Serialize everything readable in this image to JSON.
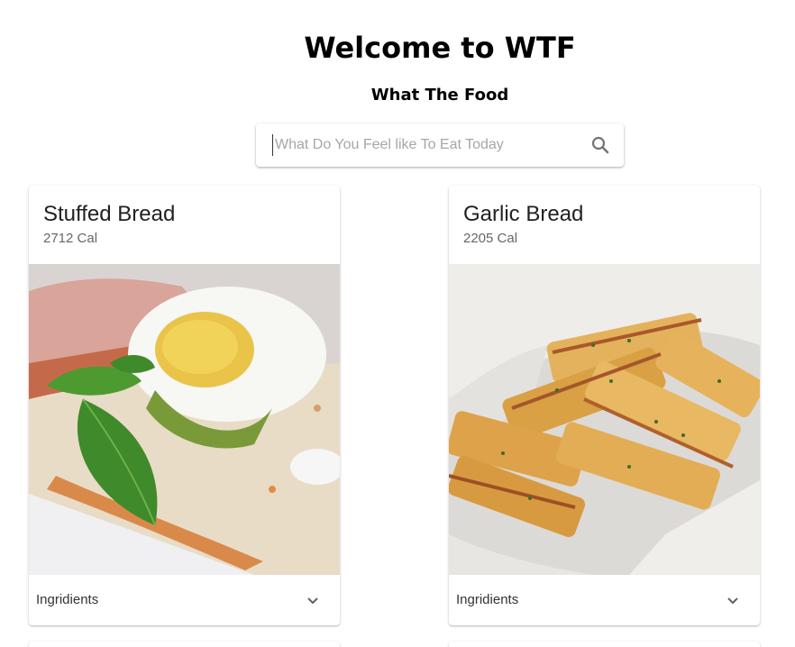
{
  "header": {
    "title": "Welcome to WTF",
    "subtitle": "What The Food"
  },
  "search": {
    "placeholder": "What Do You Feel like To Eat Today",
    "value": "",
    "icon": "search-icon"
  },
  "cards": [
    {
      "title": "Stuffed Bread",
      "calories": "2712 Cal",
      "image": "stuffed-bread-photo",
      "footer_label": "Ingridients",
      "expand_icon": "chevron-down-icon"
    },
    {
      "title": "Garlic Bread",
      "calories": "2205 Cal",
      "image": "garlic-bread-photo",
      "footer_label": "Ingridients",
      "expand_icon": "chevron-down-icon"
    }
  ],
  "colors": {
    "text_primary": "#212121",
    "text_secondary": "#666666",
    "icon": "#757575",
    "background": "#ffffff"
  }
}
